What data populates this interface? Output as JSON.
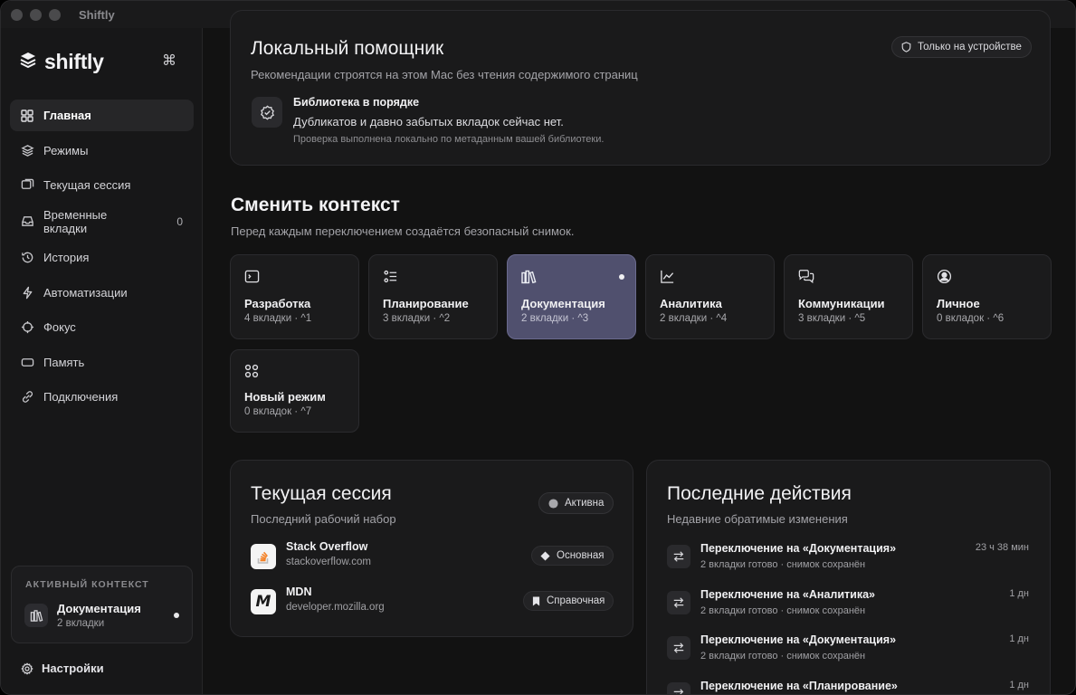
{
  "window": {
    "title": "Shiftly"
  },
  "sidebar": {
    "brand": "shiftly",
    "shortcut": "⌘",
    "items": [
      {
        "label": "Главная",
        "icon": "grid-icon",
        "active": true
      },
      {
        "label": "Режимы",
        "icon": "layers-icon"
      },
      {
        "label": "Текущая сессия",
        "icon": "windows-icon"
      },
      {
        "label": "Временные вкладки",
        "icon": "inbox-icon",
        "count": "0"
      },
      {
        "label": "История",
        "icon": "history-icon"
      },
      {
        "label": "Автоматизации",
        "icon": "bolt-icon"
      },
      {
        "label": "Фокус",
        "icon": "crosshair-icon"
      },
      {
        "label": "Память",
        "icon": "memory-icon"
      },
      {
        "label": "Подключения",
        "icon": "link-icon"
      }
    ],
    "active_context": {
      "header": "АКТИВНЫЙ КОНТЕКСТ",
      "name": "Документация",
      "tabs": "2 вкладки"
    },
    "settings_label": "Настройки"
  },
  "assistant": {
    "title": "Локальный помощник",
    "subtitle": "Рекомендации строятся на этом Mac без чтения содержимого страниц",
    "badge": "Только на устройстве",
    "status_title": "Библиотека в порядке",
    "status_text": "Дубликатов и давно забытых вкладок сейчас нет.",
    "status_note": "Проверка выполнена локально по метаданным вашей библиотеки."
  },
  "switch": {
    "title": "Сменить контекст",
    "subtitle": "Перед каждым переключением создаётся безопасный снимок.",
    "modes": [
      {
        "name": "Разработка",
        "meta": "4 вкладки · ^1",
        "icon": "terminal-icon"
      },
      {
        "name": "Планирование",
        "meta": "3 вкладки · ^2",
        "icon": "checklist-icon"
      },
      {
        "name": "Документация",
        "meta": "2 вкладки · ^3",
        "icon": "books-icon",
        "active": true
      },
      {
        "name": "Аналитика",
        "meta": "2 вкладки · ^4",
        "icon": "chart-icon"
      },
      {
        "name": "Коммуникации",
        "meta": "3 вкладки · ^5",
        "icon": "chat-icon"
      },
      {
        "name": "Личное",
        "meta": "0 вкладок · ^6",
        "icon": "person-icon"
      },
      {
        "name": "Новый режим",
        "meta": "0 вкладок · ^7",
        "icon": "apps-icon"
      }
    ]
  },
  "session": {
    "title": "Текущая сессия",
    "subtitle": "Последний рабочий набор",
    "status": "Активна",
    "sites": [
      {
        "name": "Stack Overflow",
        "url": "stackoverflow.com",
        "tag": "Основная",
        "tag_icon": "diamond-icon"
      },
      {
        "name": "MDN",
        "url": "developer.mozilla.org",
        "tag": "Справочная",
        "tag_icon": "bookmark-icon"
      }
    ]
  },
  "recent": {
    "title": "Последние действия",
    "subtitle": "Недавние обратимые изменения",
    "items": [
      {
        "title": "Переключение на «Документация»",
        "detail": "2 вкладки готово · снимок сохранён",
        "time": "23 ч 38 мин"
      },
      {
        "title": "Переключение на «Аналитика»",
        "detail": "2 вкладки готово · снимок сохранён",
        "time": "1 дн"
      },
      {
        "title": "Переключение на «Документация»",
        "detail": "2 вкладки готово · снимок сохранён",
        "time": "1 дн"
      },
      {
        "title": "Переключение на «Планирование»",
        "detail": "",
        "time": "1 дн"
      }
    ]
  },
  "colors": {
    "accent_active_mode": "#50506e",
    "background": "#121212",
    "sidebar": "#171718"
  }
}
